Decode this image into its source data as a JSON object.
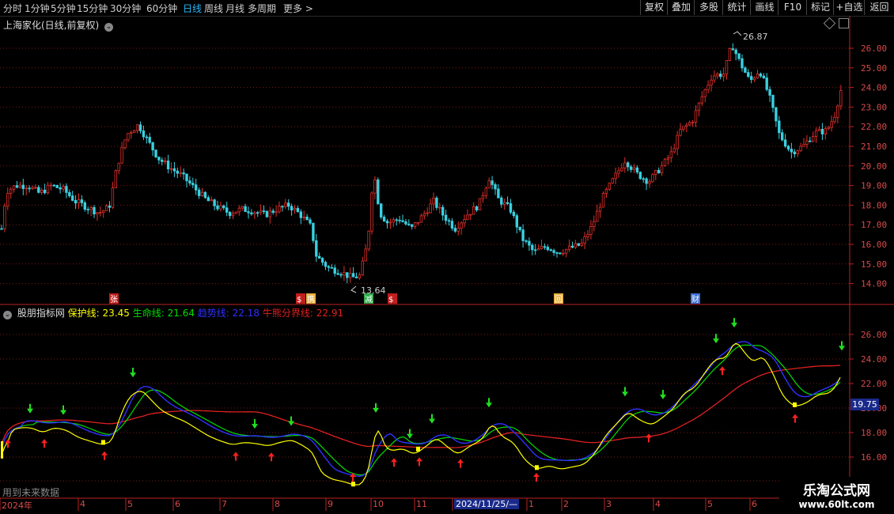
{
  "toolbar": {
    "periods": [
      {
        "label": "分时",
        "x": 4
      },
      {
        "label": "1分钟",
        "x": 31
      },
      {
        "label": "5分钟",
        "x": 64
      },
      {
        "label": "15分钟",
        "x": 97
      },
      {
        "label": "30分钟",
        "x": 139
      },
      {
        "label": "60分钟",
        "x": 185
      },
      {
        "label": "日线",
        "x": 231,
        "active": true
      },
      {
        "label": "周线",
        "x": 258
      },
      {
        "label": "月线",
        "x": 285
      },
      {
        "label": "多周期",
        "x": 313
      },
      {
        "label": "更多 >",
        "x": 358
      }
    ],
    "buttons": [
      "复权",
      "叠加",
      "多股",
      "统计",
      "画线",
      "F10",
      "标记",
      "+自选",
      "返回"
    ]
  },
  "main": {
    "title": "上海家化(日线,前复权)",
    "high_label": "26.87",
    "low_label": "13.64",
    "y_ticks": [
      "26.00",
      "25.00",
      "24.00",
      "23.00",
      "22.00",
      "21.00",
      "20.00",
      "19.00",
      "18.00",
      "17.00",
      "16.00",
      "15.00",
      "14.00"
    ],
    "markers": [
      "张",
      "$",
      "携",
      "减",
      "$",
      "回",
      "财"
    ]
  },
  "indicator": {
    "name": "股朋指标网",
    "line1_label": "保护线:",
    "line1_value": "23.45",
    "line2_label": "生命线:",
    "line2_value": "21.64",
    "line3_label": "趋势线:",
    "line3_value": "22.18",
    "line4_label": "牛熊分界线:",
    "line4_value": "22.91",
    "y_ticks": [
      "26.00",
      "24.00",
      "22.00",
      "20.00",
      "18.00",
      "16.00"
    ],
    "cursor_value": "19.75",
    "note": "用到未来数据"
  },
  "xaxis": {
    "labels": [
      "2024年",
      "4",
      "5",
      "6",
      "7",
      "8",
      "9",
      "10",
      "11",
      "2024/11/25/—",
      "1",
      "2",
      "3",
      "4",
      "5",
      "6"
    ]
  },
  "watermark": {
    "name": "乐淘公式网",
    "url": "www.60lt.com"
  },
  "colors": {
    "up": "#e0302a",
    "down": "#3ad0e0",
    "protect": "#ffff00",
    "life": "#00dd00",
    "trend": "#3030ff",
    "bull": "#e02020"
  }
}
